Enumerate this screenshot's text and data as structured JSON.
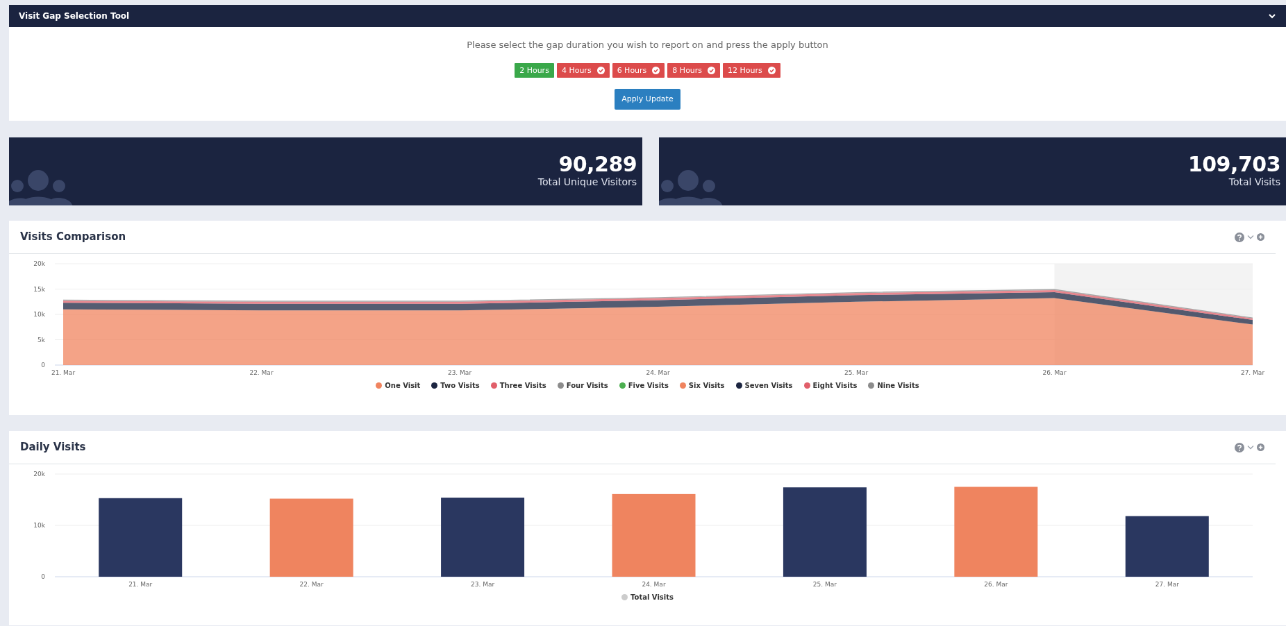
{
  "panel": {
    "title": "Visit Gap Selection Tool",
    "instruction": "Please select the gap duration you wish to report on and press the apply button",
    "gaps": [
      {
        "label": "2 Hours",
        "selected": true
      },
      {
        "label": "4 Hours",
        "selected": false
      },
      {
        "label": "6 Hours",
        "selected": false
      },
      {
        "label": "8 Hours",
        "selected": false
      },
      {
        "label": "12 Hours",
        "selected": false
      }
    ],
    "apply_button": "Apply Update"
  },
  "stats": [
    {
      "value": "90,289",
      "label": "Total Unique Visitors"
    },
    {
      "value": "109,703",
      "label": "Total Visits"
    }
  ],
  "visits_comparison": {
    "title": "Visits Comparison",
    "chart_data": {
      "type": "area",
      "stacked": true,
      "grid": true,
      "legend": "bottom",
      "categories": [
        "21. Mar",
        "22. Mar",
        "23. Mar",
        "24. Mar",
        "25. Mar",
        "26. Mar",
        "27. Mar"
      ],
      "ylim": [
        0,
        20000
      ],
      "yticks": [
        {
          "value": 0,
          "label": "0"
        },
        {
          "value": 5000,
          "label": "5k"
        },
        {
          "value": 10000,
          "label": "10k"
        },
        {
          "value": 15000,
          "label": "15k"
        },
        {
          "value": 20000,
          "label": "20k"
        }
      ],
      "bands": [
        {
          "axis": "x",
          "from": "26. Mar",
          "to": "27. Mar"
        }
      ],
      "series": [
        {
          "name": "One Visit",
          "color": "#f0845f",
          "values": [
            11000,
            10800,
            10800,
            11500,
            12500,
            13200,
            8000
          ]
        },
        {
          "name": "Two Visits",
          "color": "#1c2541",
          "values": [
            1300,
            1300,
            1300,
            1300,
            1300,
            1200,
            900
          ]
        },
        {
          "name": "Three Visits",
          "color": "#e15f6a",
          "values": [
            400,
            400,
            400,
            400,
            400,
            400,
            300
          ]
        },
        {
          "name": "Four Visits",
          "color": "#8c8c8c",
          "values": [
            200,
            200,
            200,
            200,
            200,
            200,
            200
          ]
        },
        {
          "name": "Five Visits",
          "color": "#4caf50",
          "values": [
            null,
            null,
            null,
            null,
            null,
            null,
            null
          ]
        },
        {
          "name": "Six Visits",
          "color": "#f0845f",
          "values": [
            null,
            null,
            null,
            null,
            null,
            null,
            null
          ]
        },
        {
          "name": "Seven Visits",
          "color": "#1c2541",
          "values": [
            null,
            null,
            null,
            null,
            null,
            null,
            null
          ]
        },
        {
          "name": "Eight Visits",
          "color": "#e15f6a",
          "values": [
            null,
            null,
            null,
            null,
            null,
            null,
            null
          ]
        },
        {
          "name": "Nine Visits",
          "color": "#8c8c8c",
          "values": [
            null,
            null,
            null,
            null,
            null,
            null,
            null
          ]
        }
      ]
    }
  },
  "daily_visits": {
    "title": "Daily Visits",
    "chart_data": {
      "type": "bar",
      "grid": true,
      "legend": "bottom",
      "categories": [
        "21. Mar",
        "22. Mar",
        "23. Mar",
        "24. Mar",
        "25. Mar",
        "26. Mar",
        "27. Mar"
      ],
      "ylim": [
        0,
        20000
      ],
      "yticks": [
        {
          "value": 0,
          "label": "0"
        },
        {
          "value": 10000,
          "label": "10k"
        },
        {
          "value": 20000,
          "label": "20k"
        }
      ],
      "series": [
        {
          "name": "Total Visits",
          "color": "#cccccc",
          "colors": [
            "#2a3760",
            "#ef845f",
            "#2a3760",
            "#ef845f",
            "#2a3760",
            "#ef845f",
            "#2a3760"
          ],
          "values": [
            15300,
            15200,
            15400,
            16100,
            17400,
            17500,
            11800
          ]
        }
      ]
    }
  }
}
